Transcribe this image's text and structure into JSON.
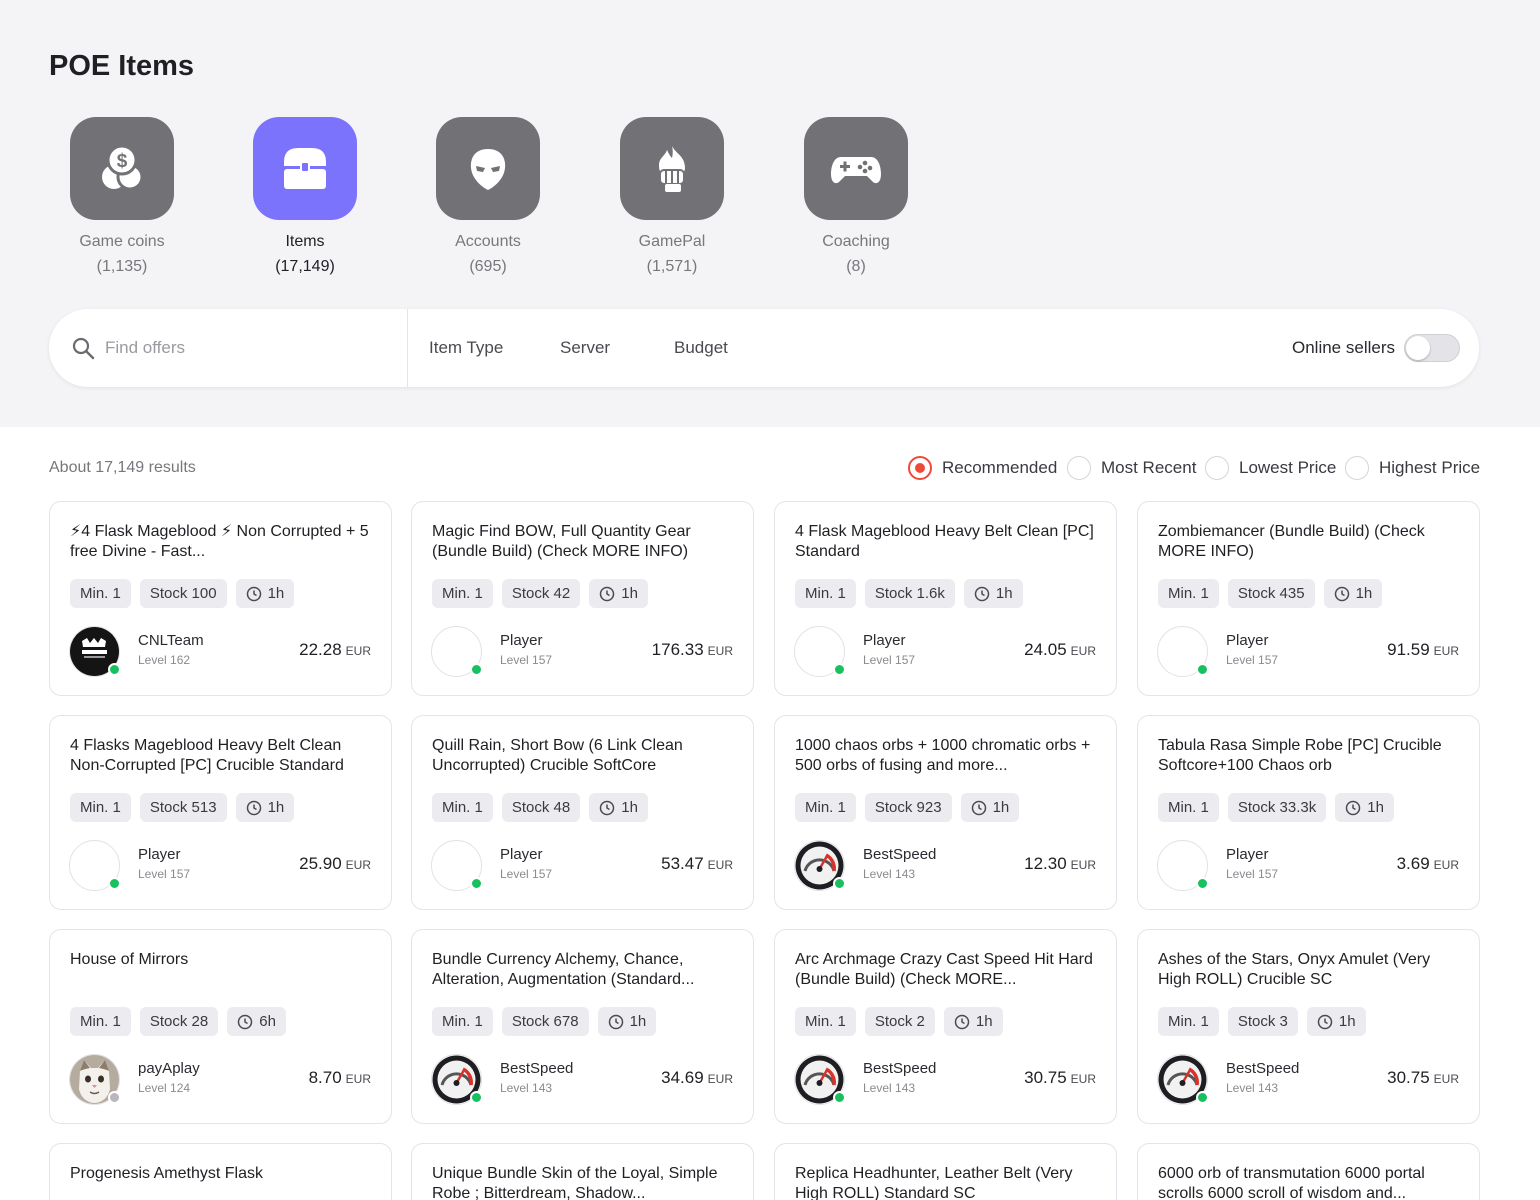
{
  "page": {
    "title": "POE Items"
  },
  "categories": [
    {
      "name": "Game coins",
      "count": "(1,135)",
      "icon": "coins-icon",
      "active": false
    },
    {
      "name": "Items",
      "count": "(17,149)",
      "icon": "treasure-chest-icon",
      "active": true
    },
    {
      "name": "Accounts",
      "count": "(695)",
      "icon": "mask-icon",
      "active": false
    },
    {
      "name": "GamePal",
      "count": "(1,571)",
      "icon": "fire-fist-icon",
      "active": false
    },
    {
      "name": "Coaching",
      "count": "(8)",
      "icon": "gamepad-icon",
      "active": false
    }
  ],
  "search": {
    "placeholder": "Find offers",
    "filters": [
      "Item Type",
      "Server",
      "Budget"
    ],
    "online_label": "Online sellers",
    "online_enabled": false
  },
  "results": {
    "summary": "About 17,149 results",
    "sort_options": [
      "Recommended",
      "Most Recent",
      "Lowest Price",
      "Highest Price"
    ],
    "selected_sort": "Recommended"
  },
  "colors": {
    "accent": "#7b73fb",
    "tile": "#717176",
    "online": "#19c05f",
    "sort_active": "#ee4a3a"
  },
  "offers": [
    {
      "title": "⚡4 Flask Mageblood ⚡ Non Corrupted + 5 free Divine - Fast...",
      "min": "Min. 1",
      "stock": "Stock 100",
      "time": "1h",
      "seller": "CNLTeam",
      "level": "Level 162",
      "price": "22.28",
      "currency": "EUR",
      "avatar": "gamer-avatar",
      "online": true
    },
    {
      "title": "Magic Find BOW, Full Quantity Gear (Bundle Build) (Check MORE INFO)",
      "min": "Min. 1",
      "stock": "Stock 42",
      "time": "1h",
      "seller": "Player",
      "level": "Level 157",
      "price": "176.33",
      "currency": "EUR",
      "avatar": "blank-avatar",
      "online": true
    },
    {
      "title": "4 Flask Mageblood Heavy Belt Clean [PC] Standard",
      "min": "Min. 1",
      "stock": "Stock 1.6k",
      "time": "1h",
      "seller": "Player",
      "level": "Level 157",
      "price": "24.05",
      "currency": "EUR",
      "avatar": "blank-avatar",
      "online": true
    },
    {
      "title": "Zombiemancer (Bundle Build) (Check MORE INFO)",
      "min": "Min. 1",
      "stock": "Stock 435",
      "time": "1h",
      "seller": "Player",
      "level": "Level 157",
      "price": "91.59",
      "currency": "EUR",
      "avatar": "blank-avatar",
      "online": true
    },
    {
      "title": "4 Flasks Mageblood Heavy Belt Clean Non-Corrupted [PC] Crucible Standard",
      "min": "Min. 1",
      "stock": "Stock 513",
      "time": "1h",
      "seller": "Player",
      "level": "Level 157",
      "price": "25.90",
      "currency": "EUR",
      "avatar": "blank-avatar",
      "online": true
    },
    {
      "title": "Quill Rain, Short Bow (6 Link Clean Uncorrupted) Crucible SoftCore",
      "min": "Min. 1",
      "stock": "Stock 48",
      "time": "1h",
      "seller": "Player",
      "level": "Level 157",
      "price": "53.47",
      "currency": "EUR",
      "avatar": "blank-avatar",
      "online": true
    },
    {
      "title": "1000 chaos orbs + 1000 chromatic orbs + 500 orbs of fusing and more...",
      "min": "Min. 1",
      "stock": "Stock 923",
      "time": "1h",
      "seller": "BestSpeed",
      "level": "Level 143",
      "price": "12.30",
      "currency": "EUR",
      "avatar": "speedometer-avatar",
      "online": true
    },
    {
      "title": "Tabula Rasa Simple Robe [PC] Crucible Softcore+100 Chaos orb",
      "min": "Min. 1",
      "stock": "Stock 33.3k",
      "time": "1h",
      "seller": "Player",
      "level": "Level 157",
      "price": "3.69",
      "currency": "EUR",
      "avatar": "blank-avatar",
      "online": true
    },
    {
      "title": "House of Mirrors",
      "min": "Min. 1",
      "stock": "Stock 28",
      "time": "6h",
      "seller": "payAplay",
      "level": "Level 124",
      "price": "8.70",
      "currency": "EUR",
      "avatar": "cat-avatar",
      "online": false
    },
    {
      "title": "Bundle Currency Alchemy, Chance, Alteration, Augmentation (Standard...",
      "min": "Min. 1",
      "stock": "Stock 678",
      "time": "1h",
      "seller": "BestSpeed",
      "level": "Level 143",
      "price": "34.69",
      "currency": "EUR",
      "avatar": "speedometer-avatar",
      "online": true
    },
    {
      "title": "Arc Archmage Crazy Cast Speed Hit Hard (Bundle Build) (Check MORE...",
      "min": "Min. 1",
      "stock": "Stock 2",
      "time": "1h",
      "seller": "BestSpeed",
      "level": "Level 143",
      "price": "30.75",
      "currency": "EUR",
      "avatar": "speedometer-avatar",
      "online": true
    },
    {
      "title": "Ashes of the Stars, Onyx Amulet (Very High ROLL) Crucible SC",
      "min": "Min. 1",
      "stock": "Stock 3",
      "time": "1h",
      "seller": "BestSpeed",
      "level": "Level 143",
      "price": "30.75",
      "currency": "EUR",
      "avatar": "speedometer-avatar",
      "online": true
    },
    {
      "title": "Progenesis Amethyst Flask"
    },
    {
      "title": "Unique Bundle Skin of the Loyal, Simple Robe ; Bitterdream, Shadow..."
    },
    {
      "title": "Replica Headhunter, Leather Belt (Very High ROLL) Standard SC"
    },
    {
      "title": "6000 orb of transmutation 6000 portal scrolls 6000 scroll of wisdom and..."
    }
  ]
}
